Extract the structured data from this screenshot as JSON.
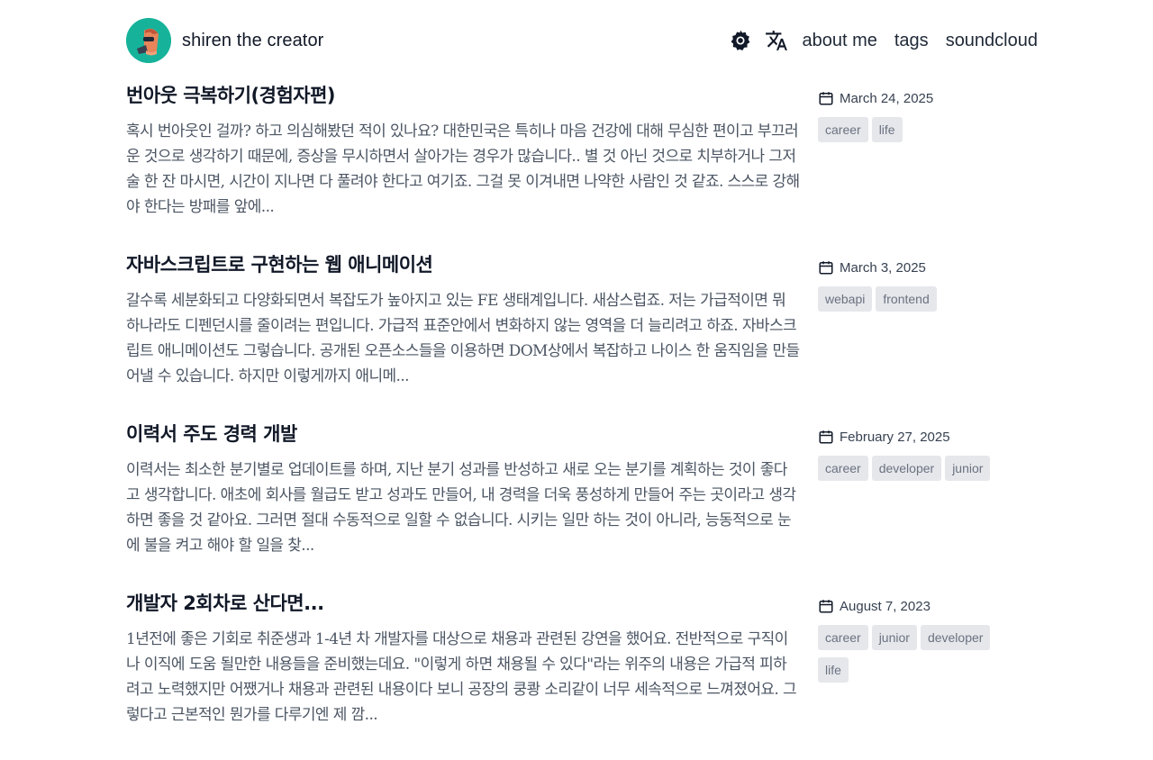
{
  "header": {
    "site_name": "shiren the creator",
    "nav": [
      {
        "label": "about me"
      },
      {
        "label": "tags"
      },
      {
        "label": "soundcloud"
      }
    ],
    "icons": {
      "theme": "gear-icon",
      "language": "translate-icon"
    }
  },
  "posts": [
    {
      "title": "번아웃 극복하기(경험자편)",
      "excerpt": "혹시 번아웃인 걸까? 하고 의심해봤던 적이 있나요? 대한민국은 특히나 마음 건강에 대해 무심한 편이고 부끄러운 것으로 생각하기 때문에, 증상을 무시하면서 살아가는 경우가 많습니다.. 별 것 아닌 것으로 치부하거나 그저 술 한 잔 마시면, 시간이 지나면 다 풀려야 한다고 여기죠. 그걸 못 이겨내면 나약한 사람인 것 같죠. 스스로 강해야 한다는 방패를 앞에...",
      "date": "March 24, 2025",
      "tags": [
        "career",
        "life"
      ]
    },
    {
      "title": "자바스크립트로 구현하는 웹 애니메이션",
      "excerpt": "갈수록 세분화되고 다양화되면서 복잡도가 높아지고 있는 FE 생태계입니다. 새삼스럽죠. 저는 가급적이면 뭐 하나라도 디펜던시를 줄이려는 편입니다. 가급적 표준안에서 변화하지 않는 영역을 더 늘리려고 하죠. 자바스크립트 애니메이션도 그렇습니다. 공개된 오픈소스들을 이용하면 DOM상에서 복잡하고 나이스 한 움직임을 만들어낼 수 있습니다. 하지만 이렇게까지 애니메...",
      "date": "March 3, 2025",
      "tags": [
        "webapi",
        "frontend"
      ]
    },
    {
      "title": "이력서 주도 경력 개발",
      "excerpt": "이력서는 최소한 분기별로 업데이트를 하며, 지난 분기 성과를 반성하고 새로 오는 분기를 계획하는 것이 좋다고 생각합니다. 애초에 회사를 월급도 받고 성과도 만들어, 내 경력을 더욱 풍성하게 만들어 주는 곳이라고 생각하면 좋을 것 같아요. 그러면 절대 수동적으로 일할 수 없습니다. 시키는 일만 하는 것이 아니라, 능동적으로 눈에 불을 켜고 해야 할 일을 찾...",
      "date": "February 27, 2025",
      "tags": [
        "career",
        "developer",
        "junior"
      ]
    },
    {
      "title": "개발자 2회차로 산다면...",
      "excerpt": "1년전에 좋은 기회로 취준생과 1-4년 차 개발자를 대상으로 채용과 관련된 강연을 했어요. 전반적으로 구직이나 이직에 도움 될만한 내용들을 준비했는데요. \"이렇게 하면 채용될 수 있다\"라는 위주의 내용은 가급적 피하려고 노력했지만 어쨌거나 채용과 관련된 내용이다 보니 공장의 쿵쾅 소리같이 너무 세속적으로 느껴졌어요. 그렇다고 근본적인 뭔가를 다루기엔 제 깜...",
      "date": "August 7, 2023",
      "tags": [
        "career",
        "junior",
        "developer",
        "life"
      ]
    }
  ]
}
